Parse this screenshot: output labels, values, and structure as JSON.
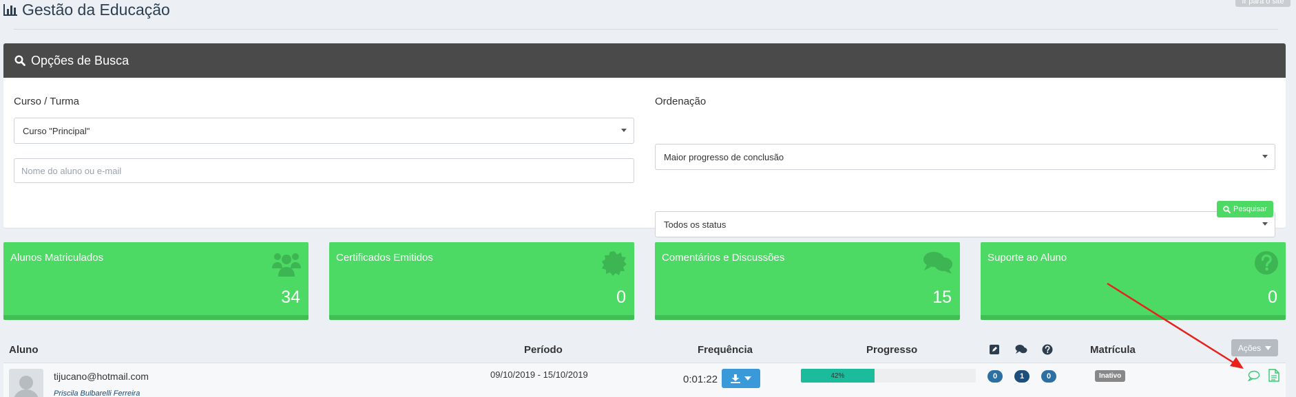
{
  "header": {
    "title": "Gestão da Educação",
    "site_button": "Ir para o site"
  },
  "search_panel": {
    "title": "Opções de Busca",
    "course_label": "Curso / Turma",
    "course_value": "Curso \"Principal\"",
    "student_placeholder": "Nome do aluno ou e-mail",
    "order_label": "Ordenação",
    "order_value": "Maior progresso de conclusão",
    "status_value": "Todos os status",
    "search_button": "Pesquisar"
  },
  "stats": [
    {
      "title": "Alunos Matriculados",
      "value": "34",
      "icon": "users-icon"
    },
    {
      "title": "Certificados Emitidos",
      "value": "0",
      "icon": "certificate-icon"
    },
    {
      "title": "Comentários e Discussões",
      "value": "15",
      "icon": "comments-icon"
    },
    {
      "title": "Suporte ao Aluno",
      "value": "0",
      "icon": "question-icon"
    }
  ],
  "table": {
    "headers": {
      "student": "Aluno",
      "period": "Período",
      "frequency": "Frequência",
      "progress": "Progresso",
      "enrollment": "Matrícula"
    },
    "actions_button": "Ações",
    "rows": [
      {
        "email": "tijucano@hotmail.com",
        "name": "Priscila Bulbarelli Ferreira",
        "period": "09/10/2019 - 15/10/2019",
        "frequency": "0:01:22",
        "progress_label": "42%",
        "progress": 0.42,
        "badge_notes": "0",
        "badge_comments": "1",
        "badge_questions": "0",
        "status": "Inativo"
      }
    ]
  },
  "colors": {
    "accent": "#4cd964",
    "panel_header": "#4a4a4a",
    "progress": "#1abc9c",
    "badge_blue": "#2c6fa3",
    "badge_dark": "#1d4f7a",
    "annotation": "#e8211d"
  }
}
